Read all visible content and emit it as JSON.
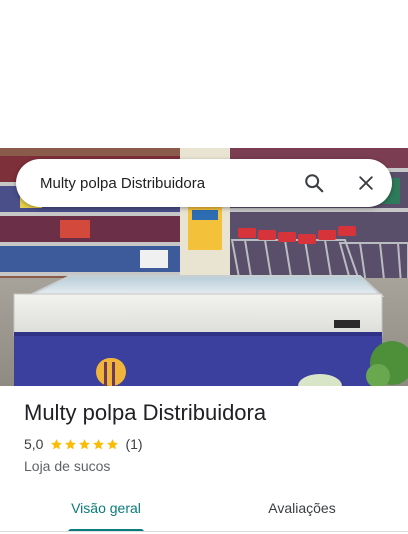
{
  "search": {
    "query": "Multy polpa Distribuidora"
  },
  "place": {
    "name": "Multy polpa Distribuidora",
    "rating_value": "5,0",
    "rating_count": "(1)",
    "stars": 5,
    "category": "Loja de sucos"
  },
  "tabs": [
    {
      "label": "Visão geral",
      "selected": true
    },
    {
      "label": "Avaliações",
      "selected": false
    }
  ],
  "colors": {
    "accent": "#0b7b7b",
    "star": "#fbbc04"
  },
  "icons": {
    "search": "search-icon",
    "close": "close-icon"
  },
  "photo": {
    "subject": "store-freezer-photo"
  }
}
